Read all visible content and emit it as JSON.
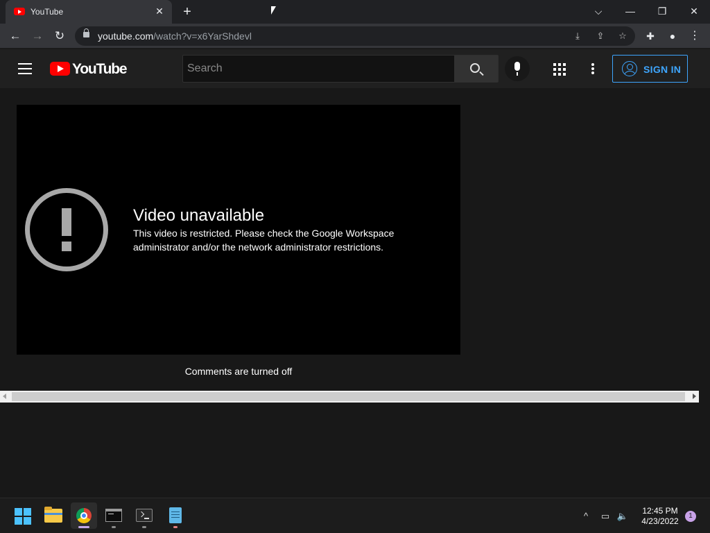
{
  "browser": {
    "tab": {
      "title": "YouTube",
      "close_glyph": "✕"
    },
    "new_tab_glyph": "+",
    "window_controls": {
      "dropdown": "⌵",
      "minimize": "—",
      "restore": "❐",
      "close": "✕"
    },
    "nav": {
      "back": "←",
      "forward": "→",
      "reload": "↻"
    },
    "url": {
      "host": "youtube.com",
      "path": "/watch?v=x6YarShdevl"
    },
    "omnibox_icons": [
      "install-icon",
      "share-icon",
      "bookmark-star-icon"
    ],
    "toolbar_icons": [
      "extensions-icon",
      "profile-icon",
      "menu-icon"
    ]
  },
  "youtube": {
    "logo_text": "YouTube",
    "search": {
      "placeholder": "Search",
      "value": ""
    },
    "sign_in_label": "SIGN IN",
    "player": {
      "error_title": "Video unavailable",
      "error_message": "This video is restricted. Please check the Google Workspace administrator and/or the network administrator restrictions."
    },
    "comments_status": "Comments are turned off"
  },
  "taskbar": {
    "apps": [
      "start-icon",
      "file-explorer-icon",
      "chrome-icon",
      "command-prompt-icon",
      "terminal-icon",
      "notepad-icon"
    ],
    "tray": {
      "chevron": "^",
      "network": "▭",
      "volume": "🔈"
    },
    "clock": {
      "time": "12:45 PM",
      "date": "4/23/2022"
    },
    "notification_count": "1"
  },
  "colors": {
    "accent_link": "#3ea6ff",
    "brand_red": "#ff0000",
    "page_bg": "#181818",
    "masthead_bg": "#202020"
  }
}
